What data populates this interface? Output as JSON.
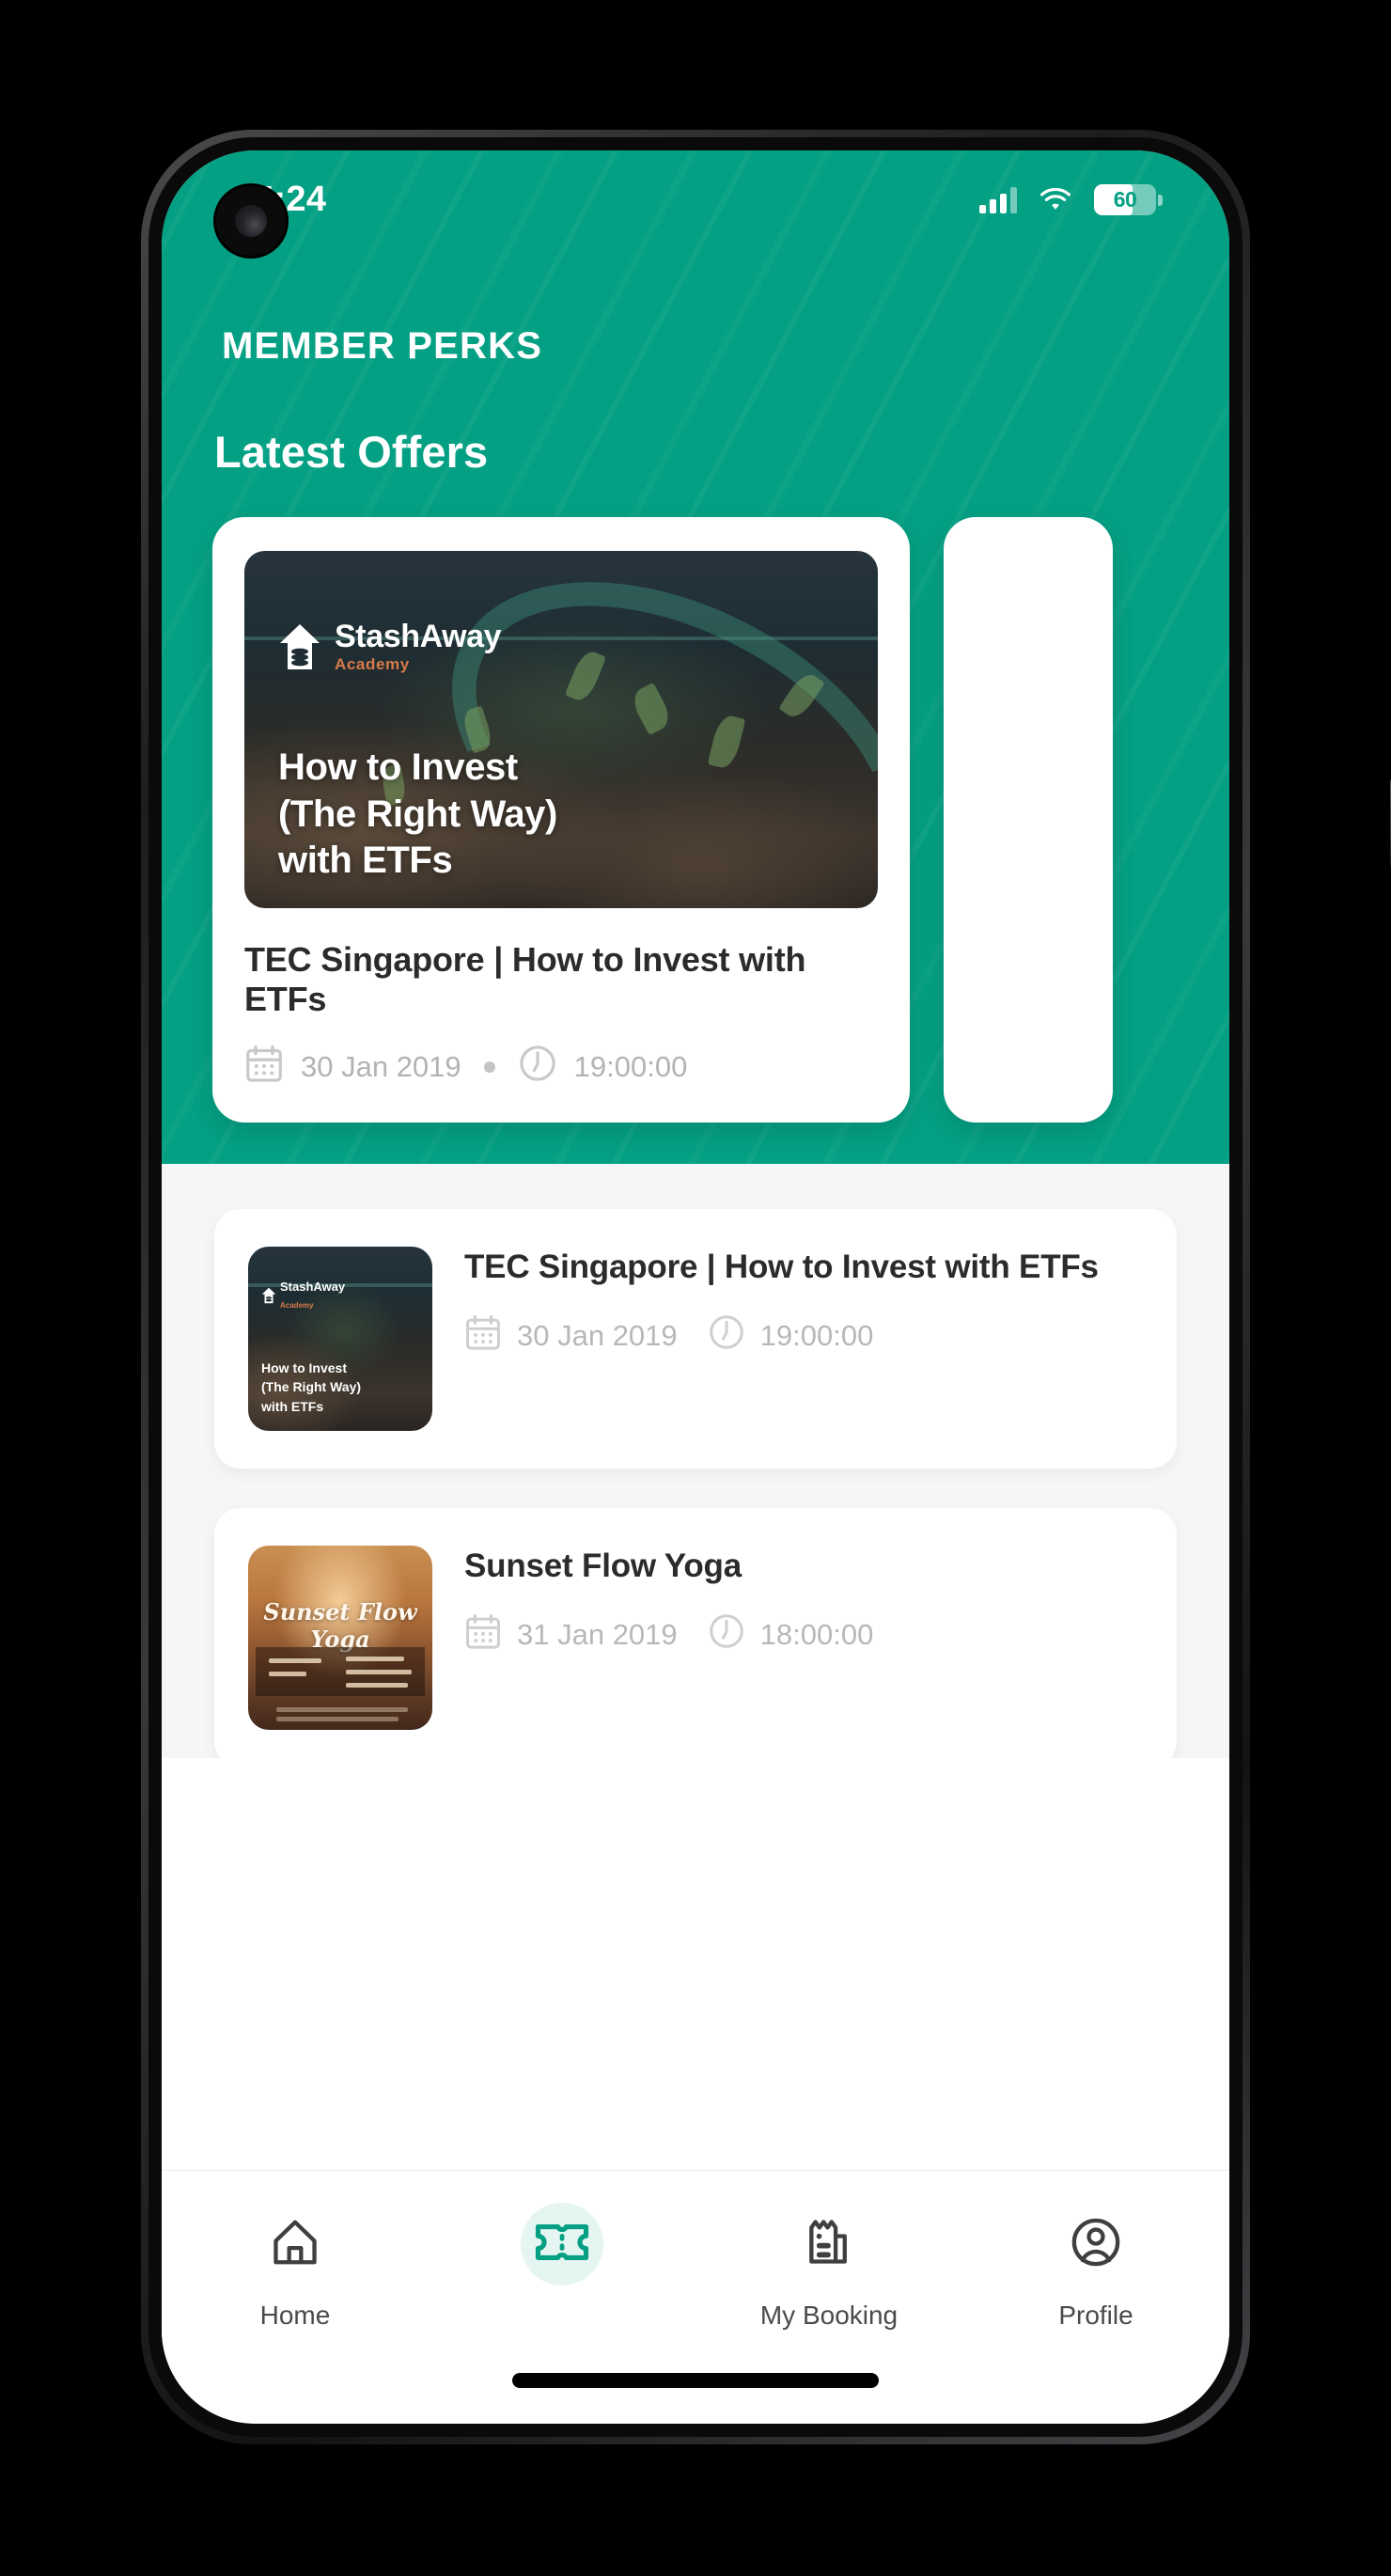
{
  "status_bar": {
    "time": "5:24",
    "battery_level": "60",
    "signal_icon": "signal-bars-icon",
    "wifi_icon": "wifi-icon",
    "battery_icon": "battery-icon"
  },
  "header": {
    "title": "MEMBER PERKS"
  },
  "latest_offers": {
    "section_title": "Latest Offers",
    "featured": {
      "image_brand_name": "StashAway",
      "image_brand_sub": "Academy",
      "image_headline_line1": "How to Invest",
      "image_headline_line2": "(The Right Way)",
      "image_headline_line3": "with ETFs",
      "title": "TEC Singapore | How to Invest with ETFs",
      "date": "30 Jan 2019",
      "time": "19:00:00",
      "calendar_icon": "calendar-icon",
      "clock-icon": "clock-icon"
    }
  },
  "offer_list": {
    "items": [
      {
        "title": "TEC Singapore | How to Invest with ETFs",
        "date": "30 Jan 2019",
        "time": "19:00:00",
        "thumb_brand_name": "StashAway",
        "thumb_brand_sub": "Academy",
        "thumb_line1": "How to Invest",
        "thumb_line2": "(The Right Way)",
        "thumb_line3": "with ETFs"
      },
      {
        "title": "Sunset Flow Yoga",
        "date": "31 Jan 2019",
        "time": "18:00:00",
        "thumb_script": "Sunset Flow Yoga"
      }
    ]
  },
  "tabbar": {
    "items": [
      {
        "label": "Home",
        "icon": "home-icon",
        "active": false
      },
      {
        "label": "",
        "icon": "ticket-icon",
        "active": true
      },
      {
        "label": "My Booking",
        "icon": "receipt-icon",
        "active": false
      },
      {
        "label": "Profile",
        "icon": "user-circle-icon",
        "active": false
      }
    ]
  },
  "colors": {
    "brand_green": "#04a083",
    "list_bg": "#f6f6f7",
    "text_dark": "#2b2b2b",
    "meta_gray": "#b3b3b3",
    "accent_orange": "#d77a4a"
  }
}
